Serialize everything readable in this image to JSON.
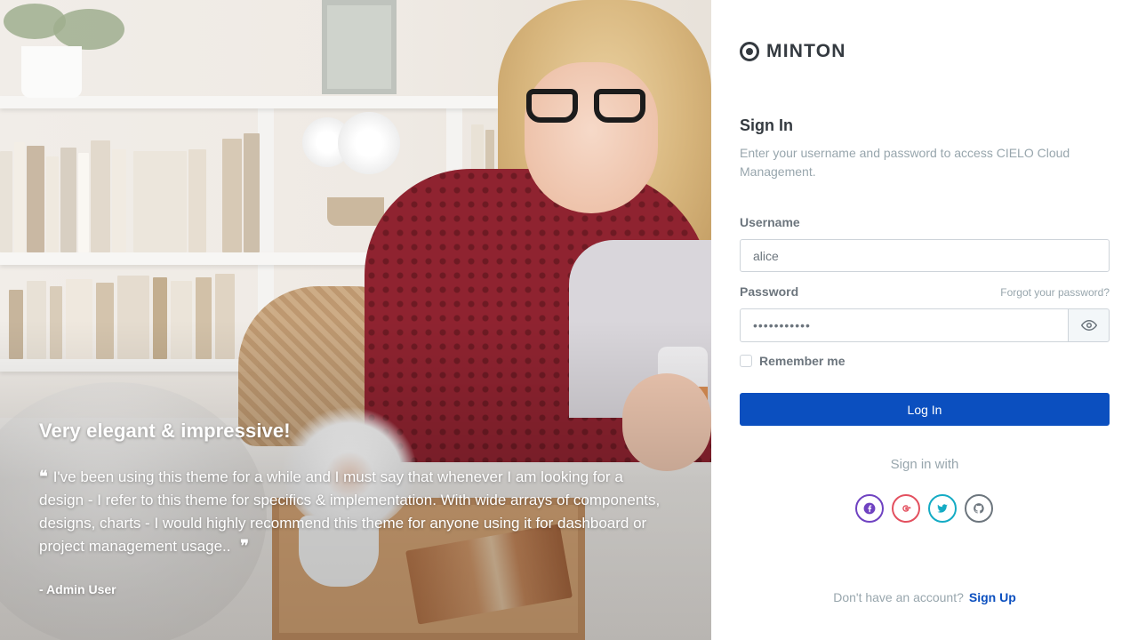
{
  "hero": {
    "heading": "Very elegant & impressive!",
    "quote": "I've been using this theme for a while and I must say that whenever I am looking for a design - I refer to this theme for specifics & implementation. With wide arrays of components, designs, charts - I would highly recommend this theme for anyone using it for dashboard or project management usage..",
    "author": "- Admin User"
  },
  "brand": {
    "name": "MINTON",
    "icon": "logo-icon"
  },
  "form": {
    "title": "Sign In",
    "subtitle": "Enter your username and password to access CIELO Cloud Management.",
    "username_label": "Username",
    "username_value": "alice",
    "password_label": "Password",
    "password_value": "•••••••••••",
    "forgot_label": "Forgot your password?",
    "remember_label": "Remember me",
    "login_label": "Log In",
    "show_password_icon": "eye-icon"
  },
  "social": {
    "title": "Sign in with",
    "providers": [
      {
        "name": "facebook",
        "icon": "facebook-icon",
        "color": "#6f42c1"
      },
      {
        "name": "google",
        "icon": "google-icon",
        "color": "#e3505f"
      },
      {
        "name": "twitter",
        "icon": "twitter-icon",
        "color": "#14abc4"
      },
      {
        "name": "github",
        "icon": "github-icon",
        "color": "#6c757d"
      }
    ]
  },
  "footer": {
    "prompt": "Don't have an account?",
    "signup_label": "Sign Up"
  },
  "colors": {
    "primary": "#0b4fbf",
    "heading": "#343a40",
    "muted": "#98a6ad",
    "border": "#ced4da"
  }
}
